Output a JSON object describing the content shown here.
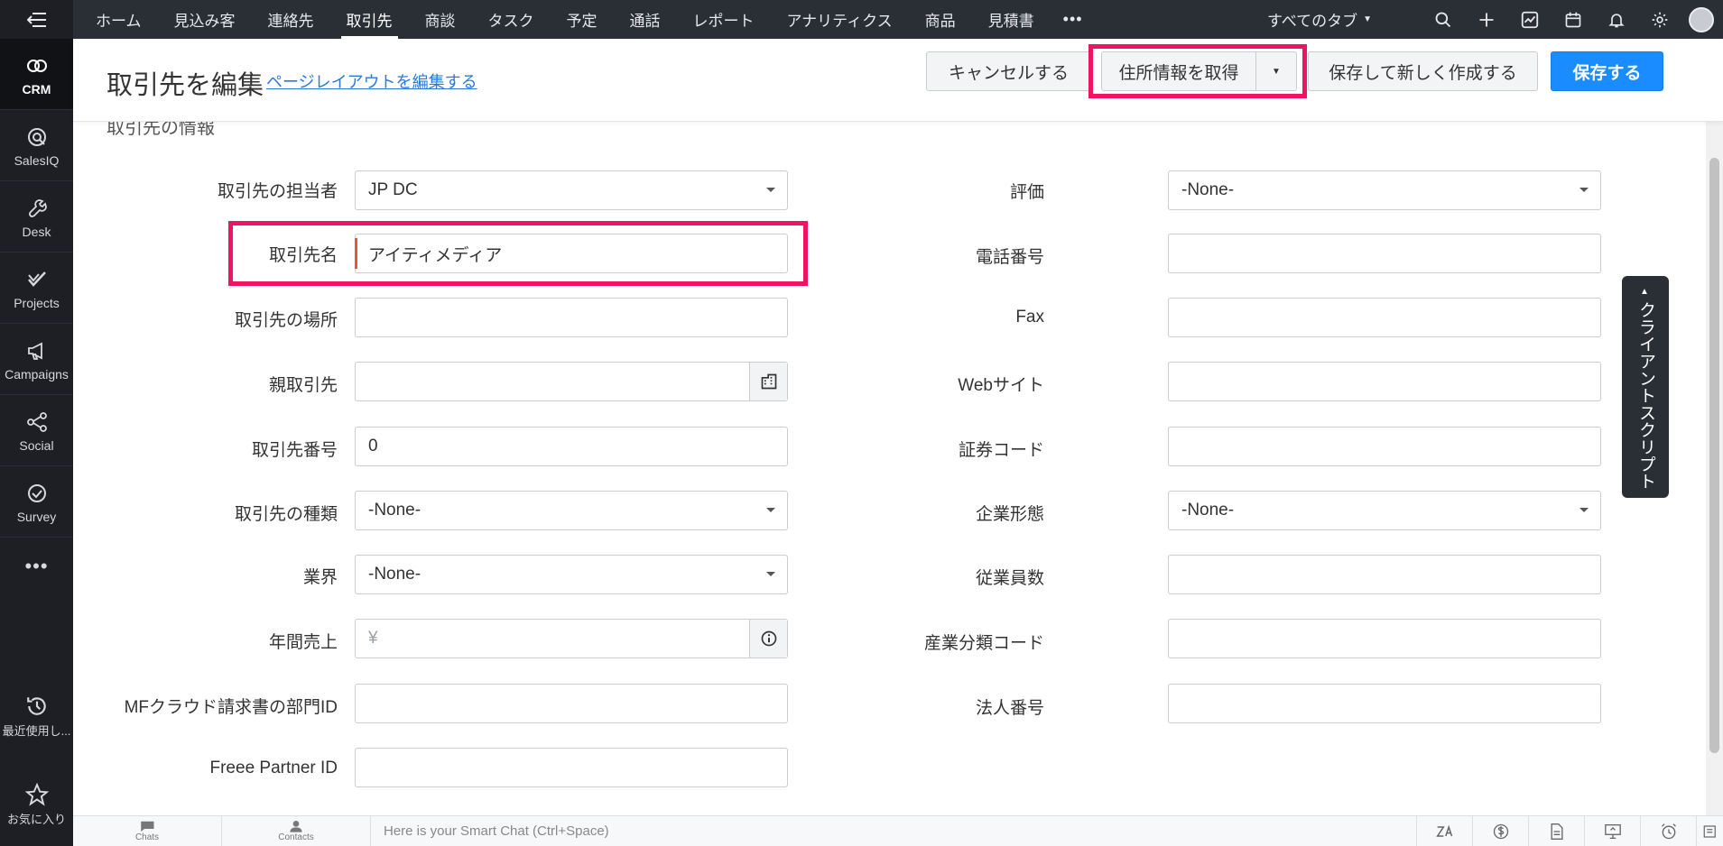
{
  "rail": {
    "items": [
      {
        "label": "CRM",
        "icon": "crm-icon"
      },
      {
        "label": "SalesIQ",
        "icon": "salesiq-icon"
      },
      {
        "label": "Desk",
        "icon": "desk-icon"
      },
      {
        "label": "Projects",
        "icon": "projects-icon"
      },
      {
        "label": "Campaigns",
        "icon": "campaigns-icon"
      },
      {
        "label": "Social",
        "icon": "social-icon"
      },
      {
        "label": "Survey",
        "icon": "survey-icon"
      }
    ],
    "more": "•••",
    "recent": "最近使用し...",
    "favorites": "お気に入り"
  },
  "nav": {
    "tabs": [
      "ホーム",
      "見込み客",
      "連絡先",
      "取引先",
      "商談",
      "タスク",
      "予定",
      "通話",
      "レポート",
      "アナリティクス",
      "商品",
      "見積書"
    ],
    "active_tab": "取引先",
    "more": "•••",
    "all_tabs": "すべてのタブ"
  },
  "header": {
    "title": "取引先を編集",
    "layout_link": "ページレイアウトを編集する",
    "cancel": "キャンセルする",
    "get_address": "住所情報を取得",
    "save_new": "保存して新しく作成する",
    "save": "保存する"
  },
  "section": {
    "title": "取引先の情報"
  },
  "fields": {
    "owner": {
      "label": "取引先の担当者",
      "value": "JP DC"
    },
    "name": {
      "label": "取引先名",
      "value": "アイティメディア"
    },
    "site": {
      "label": "取引先の場所",
      "value": ""
    },
    "parent": {
      "label": "親取引先",
      "value": ""
    },
    "number": {
      "label": "取引先番号",
      "value": "0"
    },
    "type": {
      "label": "取引先の種類",
      "value": "-None-"
    },
    "industry": {
      "label": "業界",
      "value": "-None-"
    },
    "revenue": {
      "label": "年間売上",
      "value": "",
      "placeholder": "¥"
    },
    "mf_dept": {
      "label": "MFクラウド請求書の部門ID",
      "value": ""
    },
    "freee": {
      "label": "Freee Partner ID",
      "value": ""
    },
    "rating": {
      "label": "評価",
      "value": "-None-"
    },
    "phone": {
      "label": "電話番号",
      "value": ""
    },
    "fax": {
      "label": "Fax",
      "value": ""
    },
    "website": {
      "label": "Webサイト",
      "value": ""
    },
    "ticker": {
      "label": "証券コード",
      "value": ""
    },
    "ownership": {
      "label": "企業形態",
      "value": "-None-"
    },
    "employees": {
      "label": "従業員数",
      "value": ""
    },
    "sic": {
      "label": "産業分類コード",
      "value": ""
    },
    "corp_no": {
      "label": "法人番号",
      "value": ""
    }
  },
  "client_script": "クライアントスクリプト",
  "bottom": {
    "chats": "Chats",
    "contacts": "Contacts",
    "smart_chat": "Here is your Smart Chat (Ctrl+Space)"
  },
  "colors": {
    "accent": "#1a8cff",
    "highlight": "#ee1463",
    "rail_bg": "#1d1f24",
    "nav_bg": "#2a2e35",
    "required": "#e8553d"
  }
}
